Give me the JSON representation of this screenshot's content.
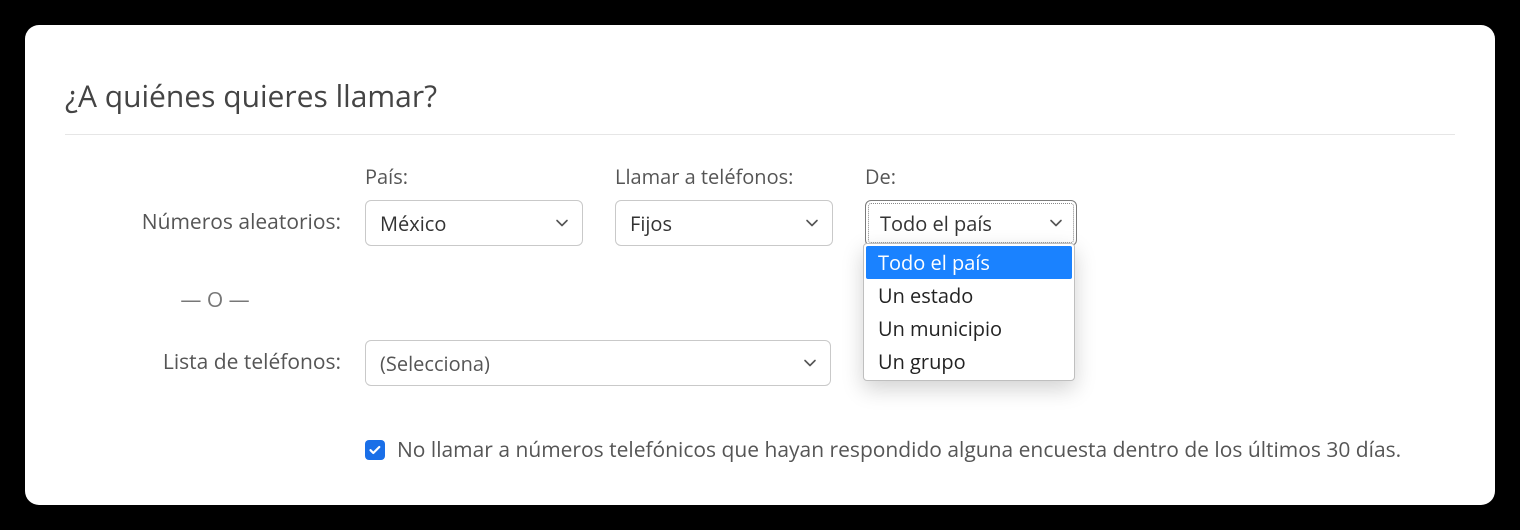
{
  "title": "¿A quiénes quieres llamar?",
  "labels": {
    "random_numbers": "Números aleatorios:",
    "country": "País:",
    "call_phones": "Llamar a teléfonos:",
    "from": "De:",
    "or": "— O —",
    "phone_list": "Lista de teléfonos:"
  },
  "selects": {
    "country": "México",
    "phones": "Fijos",
    "region": "Todo el país",
    "list": "(Selecciona)"
  },
  "region_options": [
    "Todo el país",
    "Un estado",
    "Un municipio",
    "Un grupo"
  ],
  "checkbox": {
    "checked": true,
    "label": "No llamar a números telefónicos que hayan respondido alguna encuesta dentro de los últimos 30 días."
  }
}
